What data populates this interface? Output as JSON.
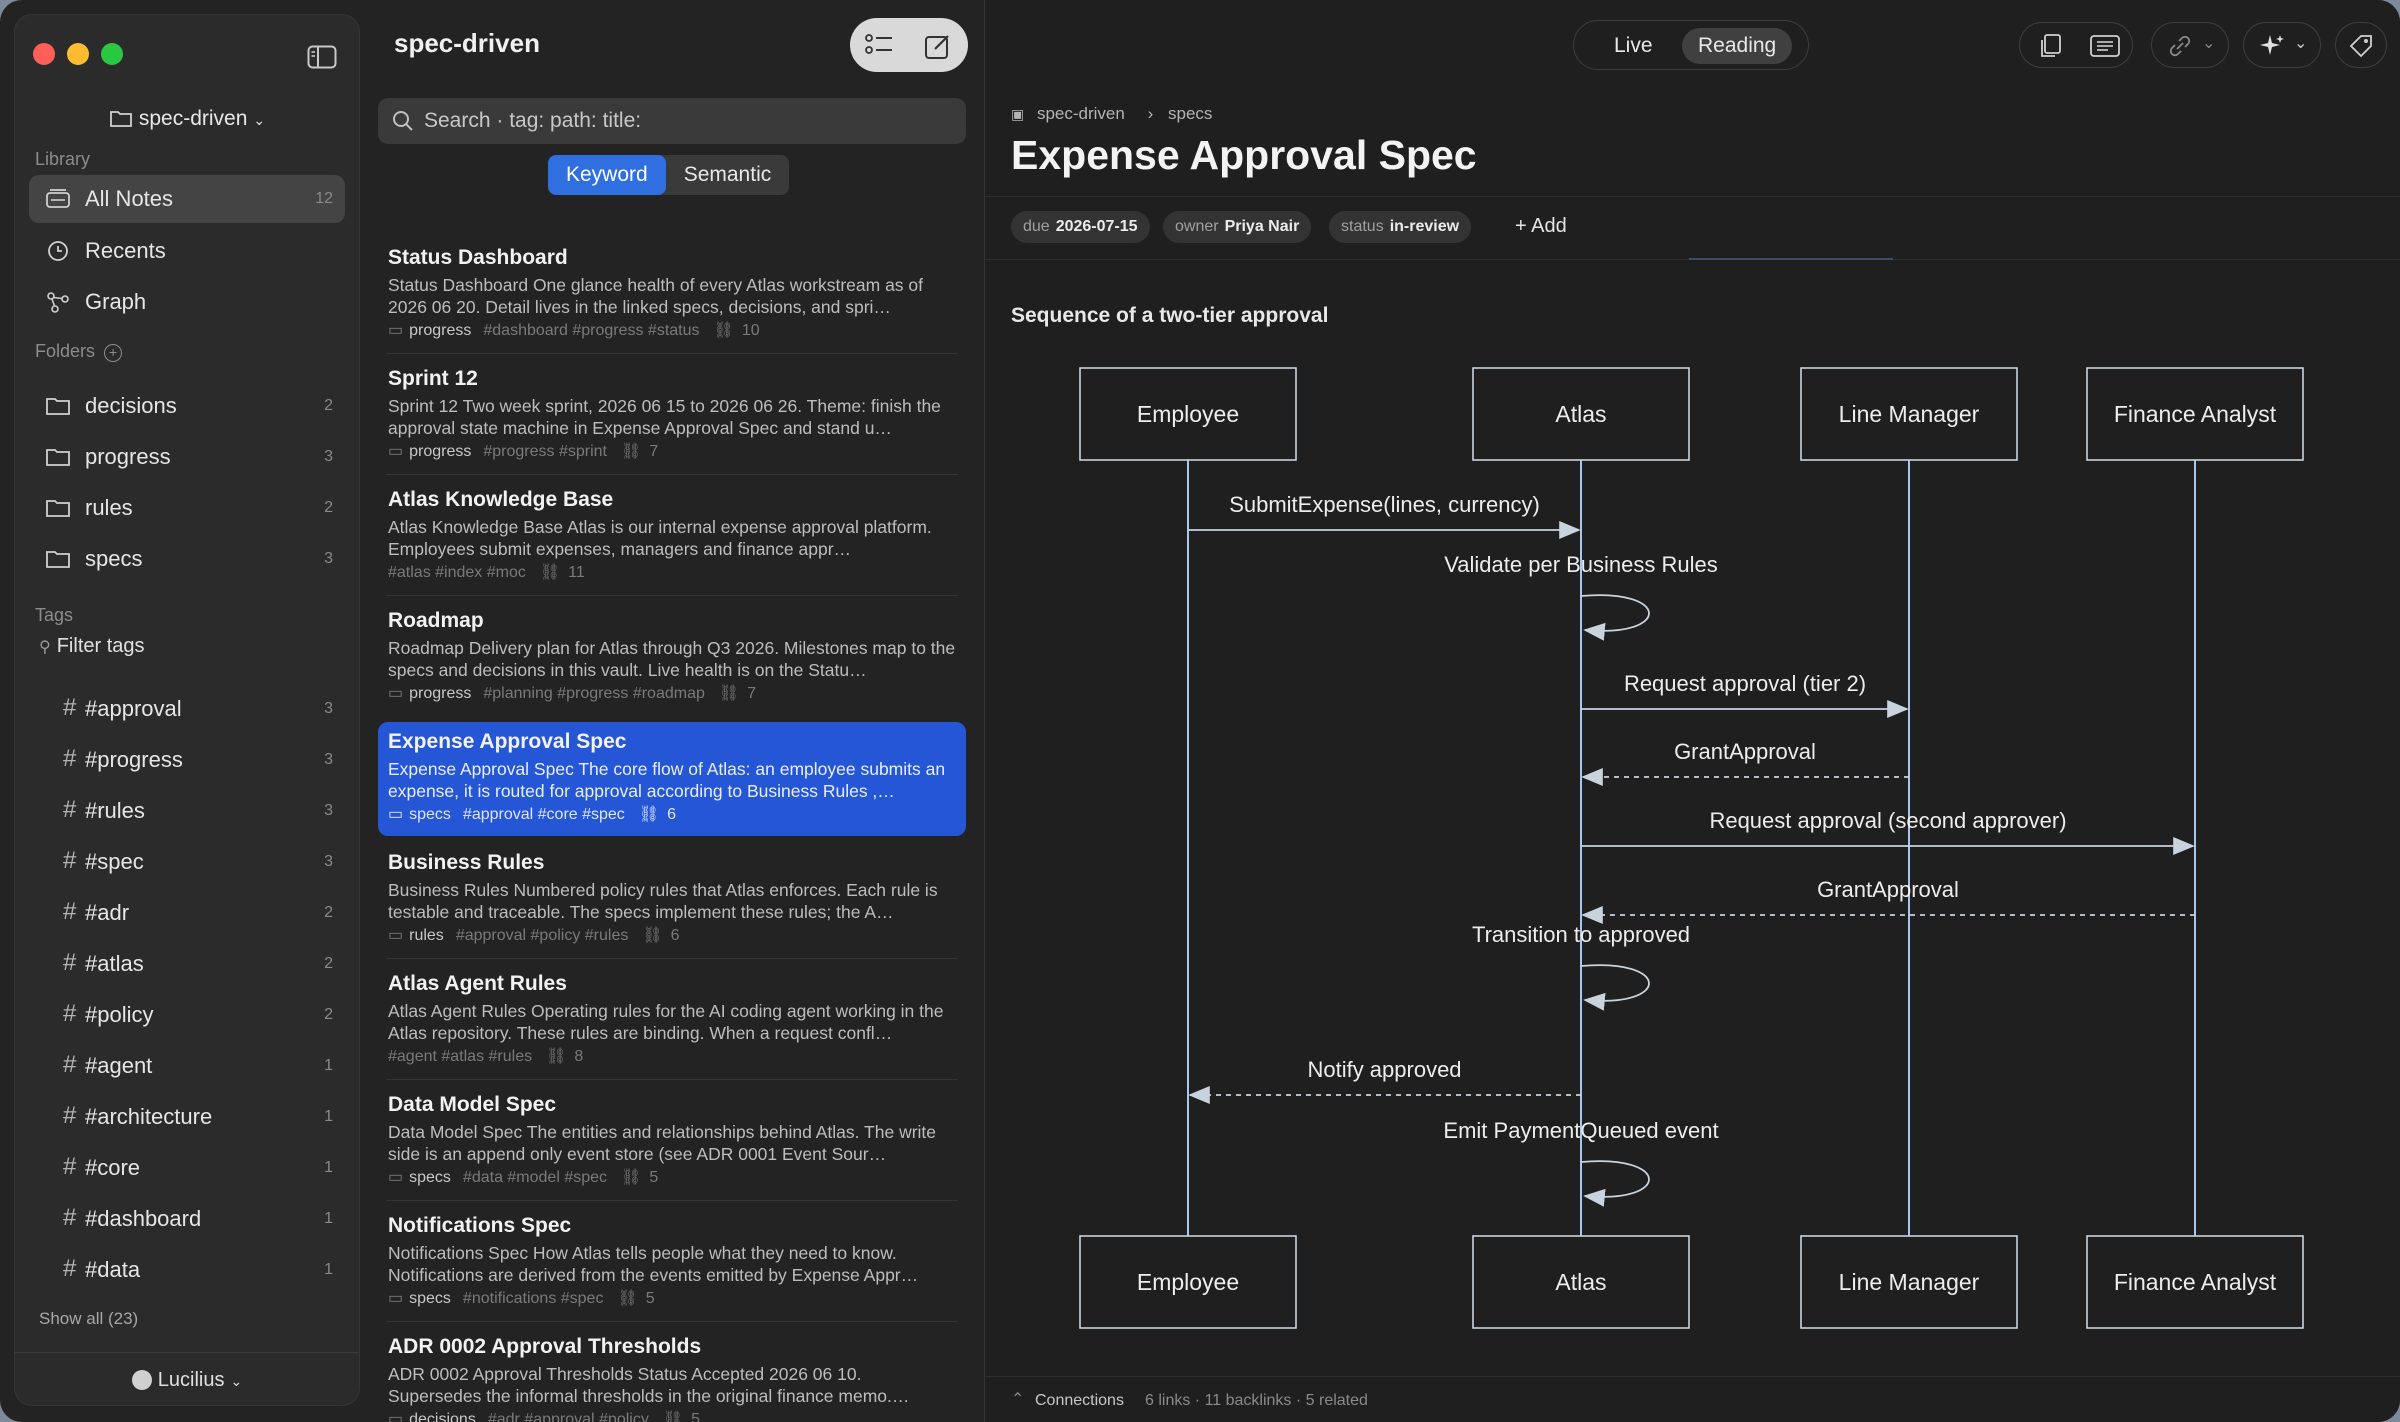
{
  "sidebar": {
    "vault_name": "spec-driven",
    "library_label": "Library",
    "library": [
      {
        "label": "All Notes",
        "count": "12"
      },
      {
        "label": "Recents",
        "count": ""
      },
      {
        "label": "Graph",
        "count": ""
      }
    ],
    "folders_label": "Folders",
    "folders": [
      {
        "label": "decisions",
        "count": "2"
      },
      {
        "label": "progress",
        "count": "3"
      },
      {
        "label": "rules",
        "count": "2"
      },
      {
        "label": "specs",
        "count": "3"
      }
    ],
    "tags_label": "Tags",
    "filter_tags": "Filter tags",
    "tags": [
      {
        "label": "#approval",
        "count": "3"
      },
      {
        "label": "#progress",
        "count": "3"
      },
      {
        "label": "#rules",
        "count": "3"
      },
      {
        "label": "#spec",
        "count": "3"
      },
      {
        "label": "#adr",
        "count": "2"
      },
      {
        "label": "#atlas",
        "count": "2"
      },
      {
        "label": "#policy",
        "count": "2"
      },
      {
        "label": "#agent",
        "count": "1"
      },
      {
        "label": "#architecture",
        "count": "1"
      },
      {
        "label": "#core",
        "count": "1"
      },
      {
        "label": "#dashboard",
        "count": "1"
      },
      {
        "label": "#data",
        "count": "1"
      }
    ],
    "show_all": "Show all (23)",
    "user": "Lucilius"
  },
  "notelist": {
    "title": "spec-driven",
    "search_placeholder": "Search  ·  tag: path: title:",
    "modes": [
      "Keyword",
      "Semantic"
    ],
    "notes": [
      {
        "title": "Status Dashboard",
        "excerpt": "Status Dashboard One glance health of every Atlas workstream as of 2026 06 20. Detail lives in the linked specs, decisions, and spri…",
        "folder": "progress",
        "tags": "#dashboard #progress #status",
        "links": "10"
      },
      {
        "title": "Sprint 12",
        "excerpt": "Sprint 12 Two week sprint, 2026 06 15 to 2026 06 26. Theme: finish the approval state machine in Expense Approval Spec and stand u…",
        "folder": "progress",
        "tags": "#progress #sprint",
        "links": "7"
      },
      {
        "title": "Atlas Knowledge Base",
        "excerpt": "Atlas Knowledge Base Atlas is our internal expense approval platform. Employees submit expenses, managers and finance appr…",
        "folder": "",
        "tags": "#atlas #index #moc",
        "links": "11"
      },
      {
        "title": "Roadmap",
        "excerpt": "Roadmap Delivery plan for Atlas through Q3 2026. Milestones map to the specs and decisions in this vault. Live health is on the Statu…",
        "folder": "progress",
        "tags": "#planning #progress #roadmap",
        "links": "7"
      },
      {
        "title": "Expense Approval Spec",
        "excerpt": "Expense Approval Spec The core flow of Atlas: an employee submits an expense, it is routed for approval according to Business Rules ,…",
        "folder": "specs",
        "tags": "#approval #core #spec",
        "links": "6"
      },
      {
        "title": "Business Rules",
        "excerpt": "Business Rules Numbered policy rules that Atlas enforces. Each rule is testable and traceable. The specs implement these rules; the A…",
        "folder": "rules",
        "tags": "#approval #policy #rules",
        "links": "6"
      },
      {
        "title": "Atlas Agent Rules",
        "excerpt": "Atlas Agent Rules Operating rules for the AI coding agent working in the Atlas repository. These rules are binding. When a request confl…",
        "folder": "",
        "tags": "#agent #atlas #rules",
        "links": "8"
      },
      {
        "title": "Data Model Spec",
        "excerpt": "Data Model Spec The entities and relationships behind Atlas. The write side is an append only event store (see ADR 0001 Event Sour…",
        "folder": "specs",
        "tags": "#data #model #spec",
        "links": "5"
      },
      {
        "title": "Notifications Spec",
        "excerpt": "Notifications Spec How Atlas tells people what they need to know. Notifications are derived from the events emitted by Expense Appr…",
        "folder": "specs",
        "tags": "#notifications #spec",
        "links": "5"
      },
      {
        "title": "ADR 0002 Approval Thresholds",
        "excerpt": "ADR 0002 Approval Thresholds Status Accepted 2026 06 10. Supersedes the informal thresholds in the original finance memo.…",
        "folder": "decisions",
        "tags": "#adr #approval #policy",
        "links": "5"
      }
    ]
  },
  "main": {
    "view_modes": [
      "Live",
      "Reading"
    ],
    "breadcrumb": [
      "spec-driven",
      "specs"
    ],
    "title": "Expense Approval Spec",
    "properties": [
      {
        "key": "due",
        "value": "2026-07-15"
      },
      {
        "key": "owner",
        "value": "Priya Nair"
      },
      {
        "key": "status",
        "value": "in-review"
      }
    ],
    "add_property": "+ Add",
    "diagram_caption": "Sequence of a two-tier approval",
    "participants": [
      "Employee",
      "Atlas",
      "Line Manager",
      "Finance Analyst"
    ],
    "messages": [
      "SubmitExpense(lines, currency)",
      "Validate per Business Rules",
      "Request approval (tier 2)",
      "GrantApproval",
      "Request approval (second approver)",
      "GrantApproval",
      "Transition to approved",
      "Notify approved",
      "Emit PaymentQueued event"
    ],
    "connections_label": "Connections",
    "connections_stats": "6 links · 11 backlinks · 5 related"
  }
}
